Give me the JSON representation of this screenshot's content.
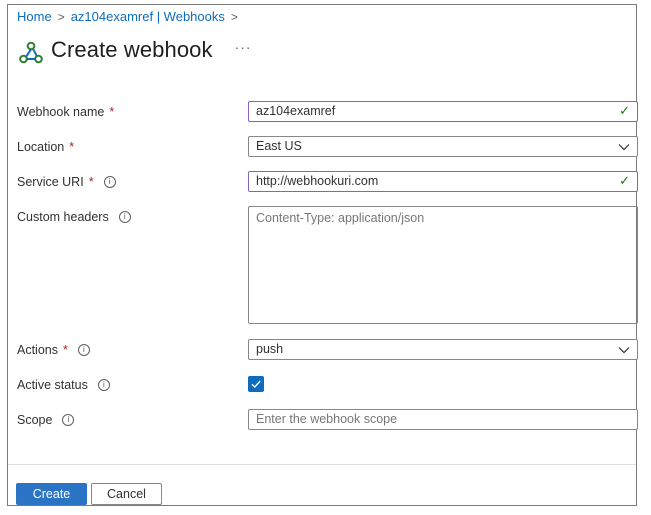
{
  "breadcrumb": {
    "home": "Home",
    "parent": "az104examref | Webhooks",
    "sep": ">"
  },
  "header": {
    "title": "Create webhook",
    "more": "···",
    "icon": "webhook-icon"
  },
  "form": {
    "webhook_name": {
      "label": "Webhook name",
      "required": "*",
      "value": "az104examref"
    },
    "location": {
      "label": "Location",
      "required": "*",
      "value": "East US"
    },
    "service_uri": {
      "label": "Service URI",
      "required": "*",
      "value": "http://webhookuri.com"
    },
    "custom_headers": {
      "label": "Custom headers",
      "placeholder": "Content-Type: application/json"
    },
    "actions": {
      "label": "Actions",
      "required": "*",
      "value": "push"
    },
    "active_status": {
      "label": "Active status",
      "checked": true
    },
    "scope": {
      "label": "Scope",
      "placeholder": "Enter the webhook scope"
    }
  },
  "footer": {
    "create": "Create",
    "cancel": "Cancel"
  },
  "colors": {
    "accent": "#0f6cbd",
    "valid_border": "#8764b8",
    "check": "#107c10",
    "required": "#a4262c"
  }
}
